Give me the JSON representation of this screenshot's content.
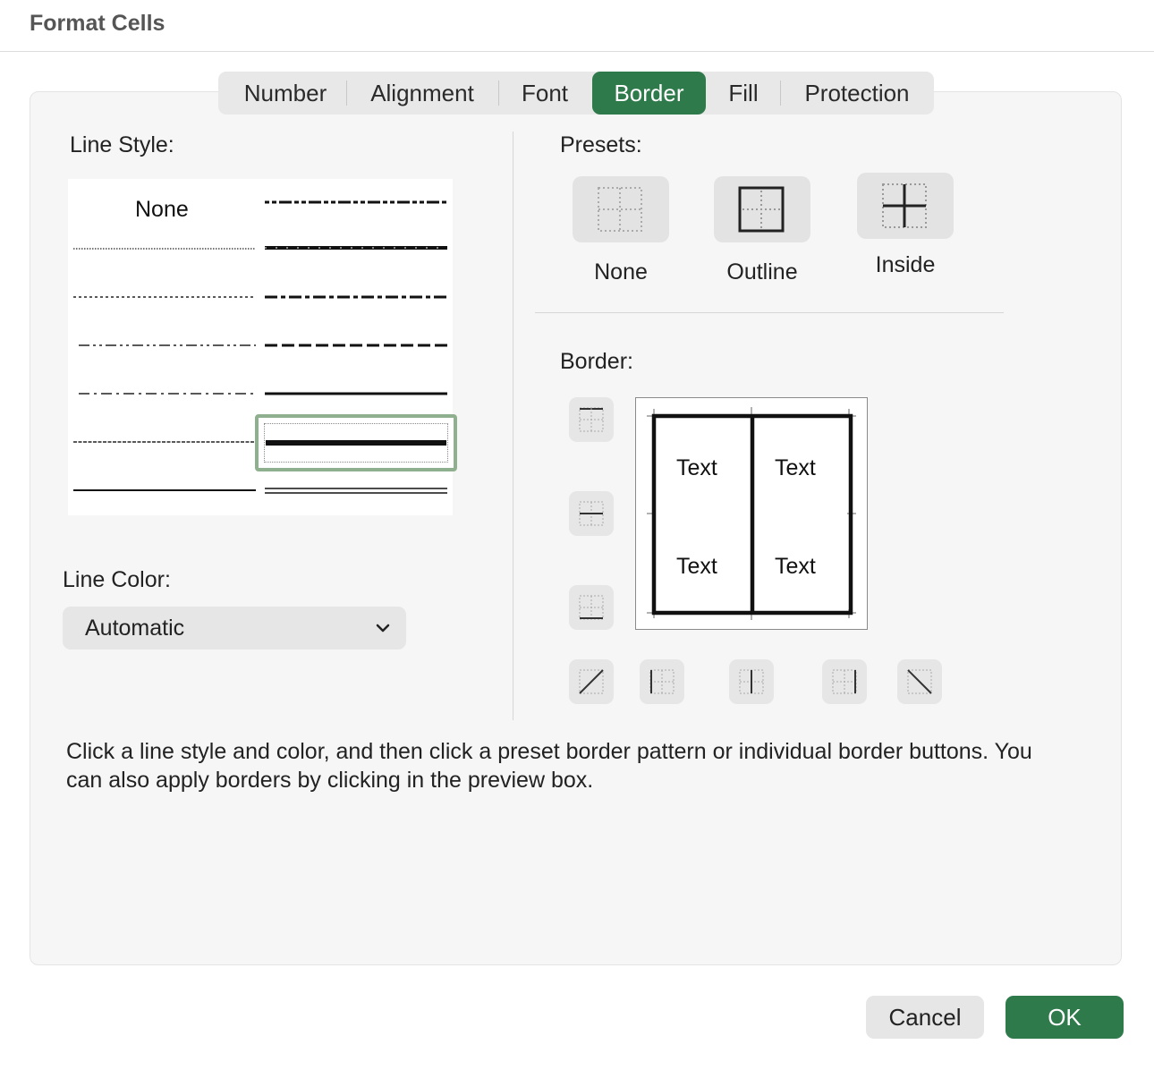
{
  "window": {
    "title": "Format Cells"
  },
  "tabs": [
    {
      "label": "Number"
    },
    {
      "label": "Alignment"
    },
    {
      "label": "Font"
    },
    {
      "label": "Border",
      "active": true
    },
    {
      "label": "Fill"
    },
    {
      "label": "Protection"
    }
  ],
  "line_style": {
    "label": "Line Style:",
    "none_label": "None",
    "selected": "thick-solid"
  },
  "line_color": {
    "label": "Line Color:",
    "value": "Automatic"
  },
  "presets": {
    "label": "Presets:",
    "items": [
      {
        "label": "None"
      },
      {
        "label": "Outline"
      },
      {
        "label": "Inside"
      }
    ]
  },
  "border": {
    "label": "Border:",
    "preview_text": [
      "Text",
      "Text",
      "Text",
      "Text"
    ]
  },
  "hint": "Click a line style and color, and then click a preset border pattern or individual border buttons. You can also apply borders by clicking in the preview box.",
  "buttons": {
    "cancel": "Cancel",
    "ok": "OK"
  },
  "colors": {
    "accent": "#2f7a4b",
    "selection_frame": "#8fb08f"
  }
}
